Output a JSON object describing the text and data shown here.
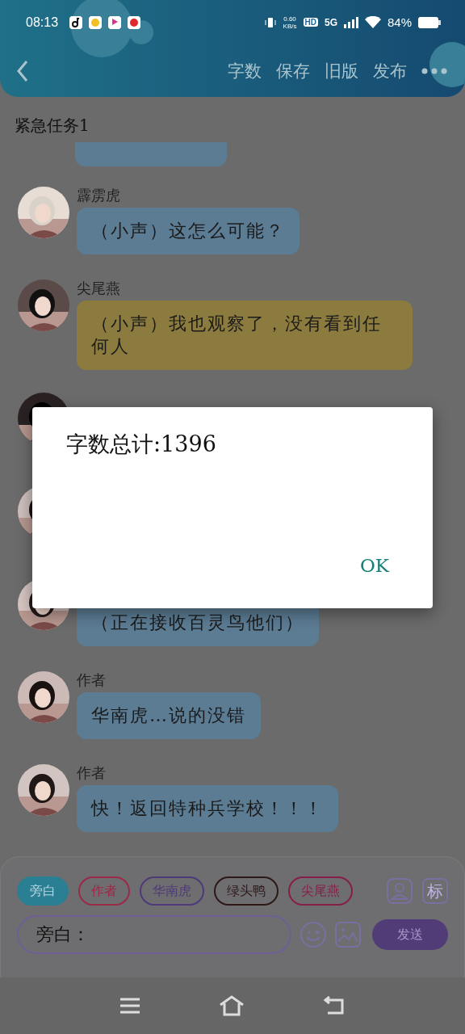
{
  "status_bar": {
    "time": "08:13",
    "net_speed": "0.60",
    "net_unit": "KB/s",
    "hd": "HD",
    "network": "5G",
    "battery": "84%"
  },
  "toolbar": {
    "actions": [
      "字数",
      "保存",
      "旧版",
      "发布"
    ]
  },
  "title": "紧急任务1",
  "messages": [
    {
      "kind": "cut",
      "color": "#5c7c94"
    },
    {
      "kind": "message",
      "name": "霹雳虎",
      "text": "（小声）这怎么可能？",
      "color": "#5c7c94"
    },
    {
      "kind": "message",
      "name": "尖尾燕",
      "text": "（小声）我也观察了，没有看到任何人",
      "color": "#8c7b3e"
    },
    {
      "kind": "covered"
    },
    {
      "kind": "covered"
    },
    {
      "kind": "message",
      "text": "（正在接收百灵鸟他们）",
      "color": "#5c7c94"
    },
    {
      "kind": "message",
      "name": "作者",
      "text": "华南虎…说的没错",
      "color": "#5c7c94"
    },
    {
      "kind": "message",
      "name": "作者",
      "text": "快！返回特种兵学校！！！",
      "color": "#5c7c94"
    }
  ],
  "roles": [
    {
      "label": "旁白",
      "selected": true,
      "color": "#2a7f92"
    },
    {
      "label": "作者",
      "selected": false,
      "color": "#9a2a48"
    },
    {
      "label": "华南虎",
      "selected": false,
      "color": "#4e3a78"
    },
    {
      "label": "绿头鸭",
      "selected": false,
      "color": "#2e1818"
    },
    {
      "label": "尖尾燕",
      "selected": false,
      "color": "#861e4a"
    }
  ],
  "tag_button": "标",
  "input": {
    "value": "旁白："
  },
  "send_button": "发送",
  "dialog": {
    "message": "字数总计:1396",
    "button": "OK"
  }
}
